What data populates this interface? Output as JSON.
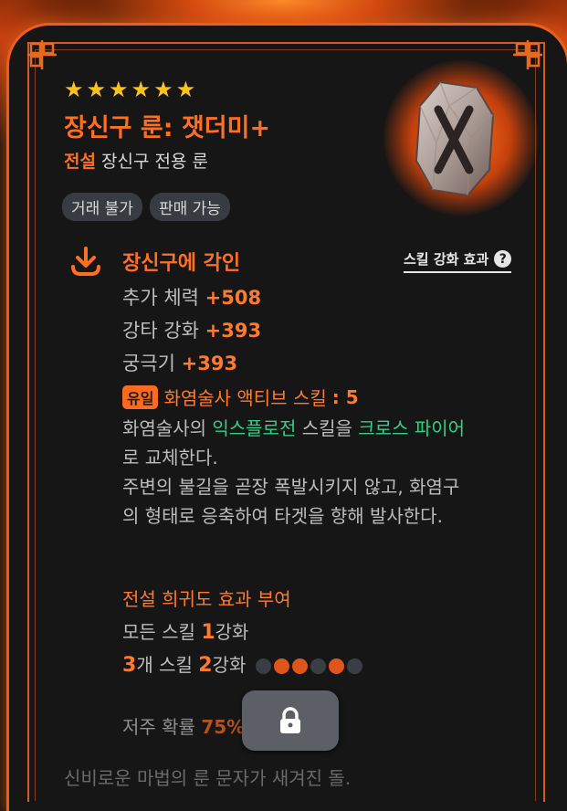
{
  "item": {
    "stars": [
      "★",
      "★",
      "★",
      "★",
      "★",
      "★"
    ],
    "title": "장신구 룬: 잿더미+",
    "grade": "전설",
    "subtitle": "장신구 전용 룬",
    "tags": [
      "거래 불가",
      "판매 가능"
    ]
  },
  "engrave": {
    "title": "장신구에 각인",
    "help_label": "스킬 강화 효과",
    "help_icon": "?",
    "stats": [
      {
        "label": "추가 체력",
        "value": "+508"
      },
      {
        "label": "강타 강화",
        "value": "+393"
      },
      {
        "label": "궁극기",
        "value": "+393"
      }
    ],
    "unique_badge": "유일",
    "unique_text": "화염술사 액티브 스킬",
    "unique_value": ": 5",
    "desc_1a": "화염술사의 ",
    "desc_1b": "익스플로전",
    "desc_1c": " 스킬을 ",
    "desc_1d": "크로스 파이어",
    "desc_1e": "로 교체한다.",
    "desc_2": "주변의 불길을 곧장 폭발시키지 않고, 화염구의 형태로 응축하여 타겟을 향해 발사한다."
  },
  "grant": {
    "title": "전설 희귀도 효과 부여",
    "line1_a": "모든 스킬 ",
    "line1_n": "1",
    "line1_b": "강화",
    "line2_n1": "3",
    "line2_a": "개 스킬 ",
    "line2_n2": "2",
    "line2_b": "강화",
    "dots": [
      false,
      true,
      true,
      false,
      true,
      false
    ]
  },
  "curse": {
    "label": "저주 확률 ",
    "value": "75%"
  },
  "flavor": "신비로운 마법의 룬 문자가 새겨진 돌.",
  "colors": {
    "accent": "#ff6f22",
    "green": "#2fd08a",
    "star": "#ffc21a"
  }
}
